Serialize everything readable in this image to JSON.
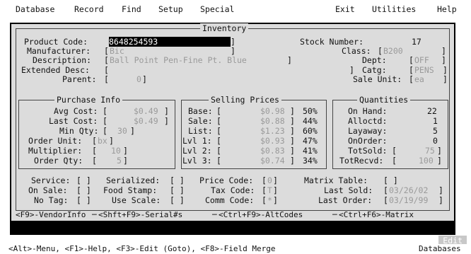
{
  "menu": {
    "left": [
      "Database",
      "Record",
      "Find",
      "Setup",
      "Special"
    ],
    "right": [
      "Exit",
      "Utilities",
      "Help"
    ]
  },
  "window": {
    "title": "Inventory"
  },
  "product": {
    "code_label": "Product Code:",
    "code_value": "8648254593",
    "manufacturer_label": "Manufacturer:",
    "manufacturer_value": "Bic",
    "description_label": "Description:",
    "description_value": "Ball Point Pen-Fine Pt. Blue",
    "extended_label": "Extended Desc:",
    "parent_label": "Parent:",
    "parent_value": "0",
    "stock_number_label": "Stock Number:",
    "stock_number_value": "17",
    "class_label": "Class:",
    "class_value": "B200",
    "dept_label": "Dept:",
    "dept_value": "OFF",
    "catg_label": "Catg:",
    "catg_value": "PENS",
    "sale_unit_label": "Sale Unit:",
    "sale_unit_value": "ea"
  },
  "purchase": {
    "title": "Purchase Info",
    "rows": [
      {
        "label": "Avg Cost:",
        "value": "$0.49"
      },
      {
        "label": "Last Cost:",
        "value": "$0.49"
      },
      {
        "label": "Min Qty:",
        "value": "30"
      },
      {
        "label": "Order Unit:",
        "value": "bx"
      },
      {
        "label": "Multiplier:",
        "value": "10"
      },
      {
        "label": "Order Qty:",
        "value": "5"
      }
    ]
  },
  "selling": {
    "title": "Selling Prices",
    "rows": [
      {
        "label": "Base:",
        "value": "$0.98",
        "pct": "50%"
      },
      {
        "label": "Sale:",
        "value": "$0.88",
        "pct": "44%"
      },
      {
        "label": "List:",
        "value": "$1.23",
        "pct": "60%"
      },
      {
        "label": "Lvl 1:",
        "value": "$0.93",
        "pct": "47%"
      },
      {
        "label": "Lvl 2:",
        "value": "$0.83",
        "pct": "41%"
      },
      {
        "label": "Lvl 3:",
        "value": "$0.74",
        "pct": "34%"
      }
    ]
  },
  "quantities": {
    "title": "Quantities",
    "rows": [
      {
        "label": "On Hand:",
        "value": "22"
      },
      {
        "label": "Alloctd:",
        "value": "1"
      },
      {
        "label": "Layaway:",
        "value": "5"
      },
      {
        "label": "OnOrder:",
        "value": "0"
      },
      {
        "label": "TotSold:",
        "value": "75"
      },
      {
        "label": "TotRecvd:",
        "value": "100"
      }
    ]
  },
  "flags": {
    "service_label": "Service:",
    "on_sale_label": "On Sale:",
    "no_tag_label": "No Tag:",
    "serialized_label": "Serialized:",
    "food_stamp_label": "Food Stamp:",
    "use_scale_label": "Use Scale:",
    "price_code_label": "Price Code:",
    "price_code_value": "0",
    "tax_code_label": "Tax Code:",
    "tax_code_value": "T",
    "comm_code_label": "Comm Code:",
    "comm_code_value": "*",
    "matrix_table_label": "Matrix Table:",
    "last_sold_label": "Last Sold:",
    "last_sold_value": "03/26/02",
    "last_order_label": "Last Order:",
    "last_order_value": "03/19/99"
  },
  "fkeys": [
    "<F9>-VendorInfo",
    "<Shft+F9>-Serial#s",
    "<Ctrl+F9>-AltCodes",
    "<Ctrl+F6>-Matrix"
  ],
  "mode": "Edit",
  "status": {
    "hint": "<Alt>-Menu, <F1>-Help, <F3>-Edit (Goto), <F8>-Field Merge",
    "right": "Databases"
  }
}
